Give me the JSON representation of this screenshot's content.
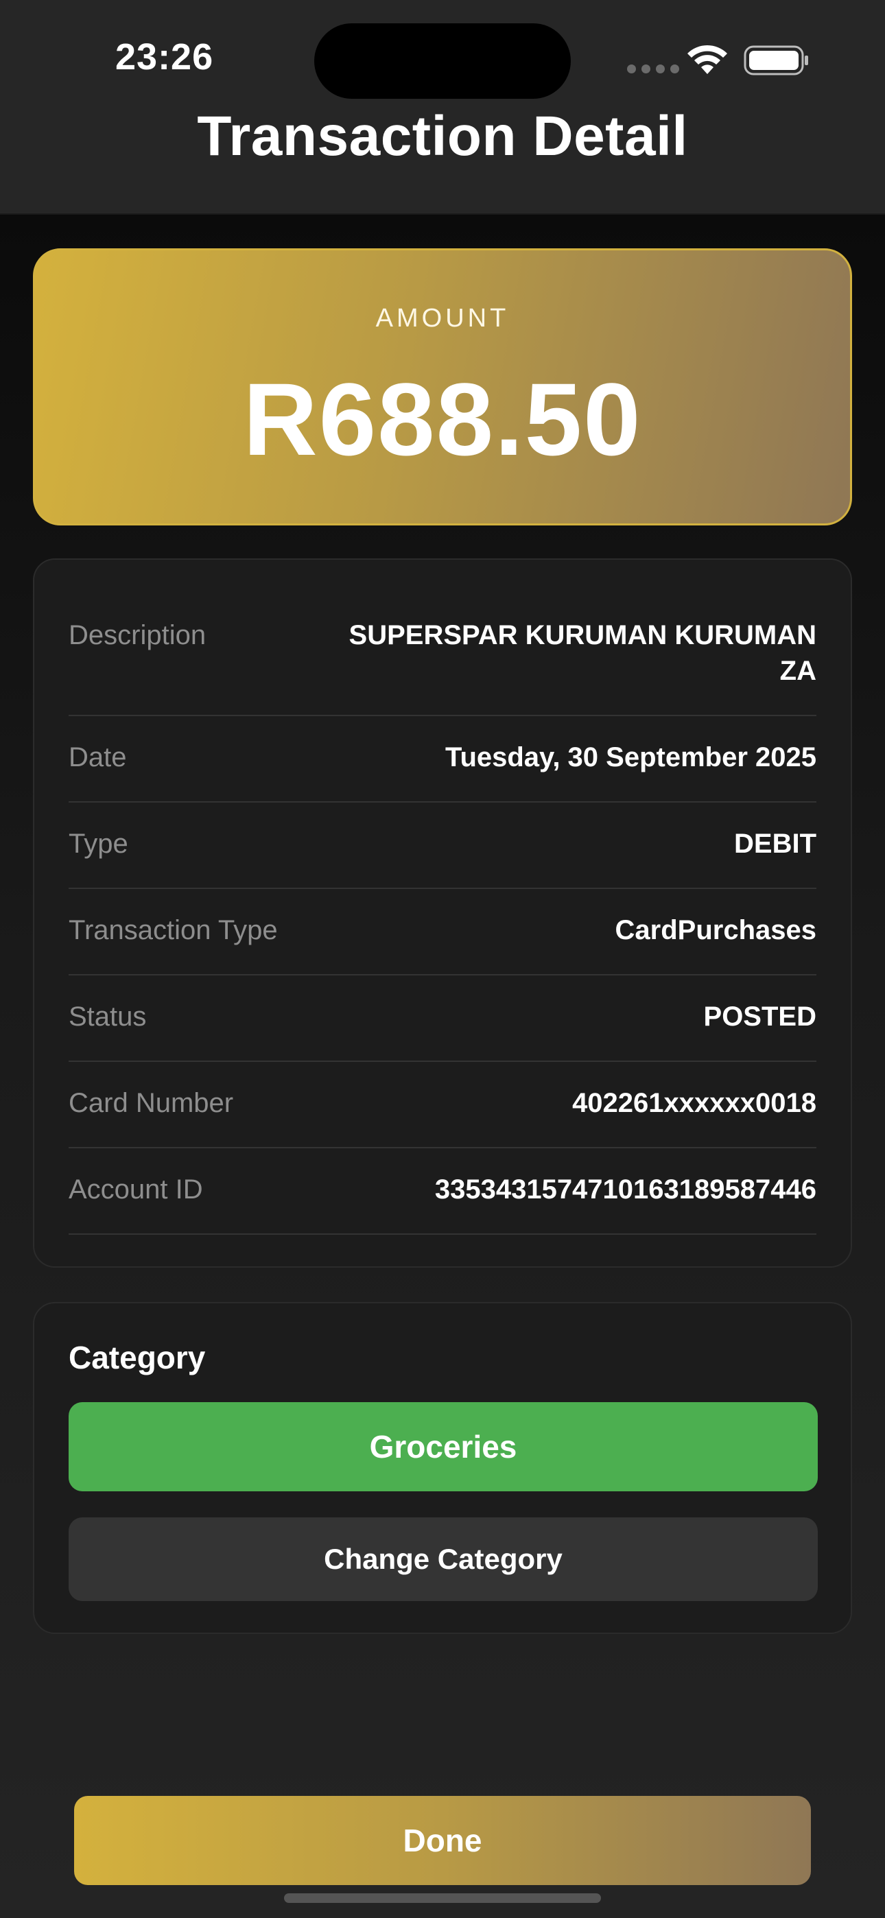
{
  "status_bar": {
    "time": "23:26"
  },
  "header": {
    "title": "Transaction Detail"
  },
  "amount_card": {
    "label": "AMOUNT",
    "value": "R688.50"
  },
  "details": [
    {
      "label": "Description",
      "value": "SUPERSPAR KURUMAN KURUMAN ZA"
    },
    {
      "label": "Date",
      "value": "Tuesday, 30 September 2025"
    },
    {
      "label": "Type",
      "value": "DEBIT"
    },
    {
      "label": "Transaction Type",
      "value": "CardPurchases"
    },
    {
      "label": "Status",
      "value": "POSTED"
    },
    {
      "label": "Card Number",
      "value": "402261xxxxxx0018"
    },
    {
      "label": "Account ID",
      "value": "3353431574710163189587446"
    }
  ],
  "category": {
    "title": "Category",
    "current": "Groceries",
    "current_color": "#4caf50",
    "change_label": "Change Category"
  },
  "footer": {
    "done_label": "Done"
  },
  "colors": {
    "accent_gold": "#d4b13d",
    "accent_bronze": "#8f7755",
    "background": "#0b0b0b",
    "card": "#1c1c1c"
  },
  "icons": [
    "wifi-icon",
    "battery-icon",
    "signal-dots-icon"
  ]
}
